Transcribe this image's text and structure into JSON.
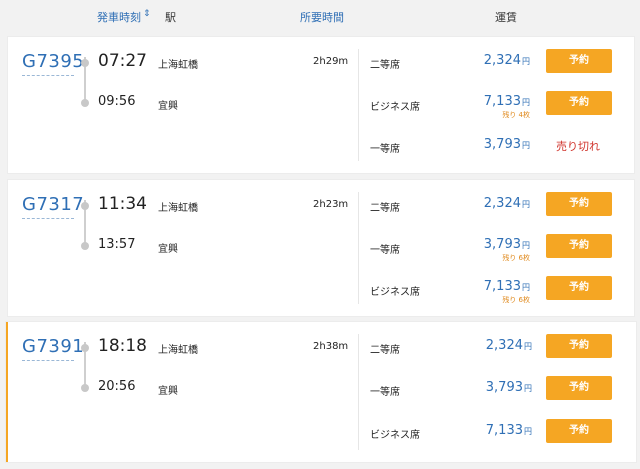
{
  "header": {
    "departure_label": "発車時刻",
    "sort_icon": "⇕",
    "station_label": "駅",
    "duration_label": "所要時間",
    "fare_label": "運賃"
  },
  "trains": [
    {
      "number": "G7395",
      "dep_time": "07:27",
      "arr_time": "09:56",
      "dep_station": "上海虹橋",
      "arr_station": "宜興",
      "duration": "2h29m",
      "fares": [
        {
          "class": "二等席",
          "price": "2,324",
          "yen": "円",
          "remaining": "",
          "action": "予約"
        },
        {
          "class": "ビジネス席",
          "price": "7,133",
          "yen": "円",
          "remaining": "残り 4枚",
          "action": "予約"
        },
        {
          "class": "一等席",
          "price": "3,793",
          "yen": "円",
          "remaining": "",
          "action": "売り切れ"
        }
      ]
    },
    {
      "number": "G7317",
      "dep_time": "11:34",
      "arr_time": "13:57",
      "dep_station": "上海虹橋",
      "arr_station": "宜興",
      "duration": "2h23m",
      "fares": [
        {
          "class": "二等席",
          "price": "2,324",
          "yen": "円",
          "remaining": "",
          "action": "予約"
        },
        {
          "class": "一等席",
          "price": "3,793",
          "yen": "円",
          "remaining": "残り 6枚",
          "action": "予約"
        },
        {
          "class": "ビジネス席",
          "price": "7,133",
          "yen": "円",
          "remaining": "残り 6枚",
          "action": "予約"
        }
      ]
    },
    {
      "number": "G7391",
      "dep_time": "18:18",
      "arr_time": "20:56",
      "dep_station": "上海虹橋",
      "arr_station": "宜興",
      "duration": "2h38m",
      "fares": [
        {
          "class": "二等席",
          "price": "2,324",
          "yen": "円",
          "remaining": "",
          "action": "予約"
        },
        {
          "class": "一等席",
          "price": "3,793",
          "yen": "円",
          "remaining": "",
          "action": "予約"
        },
        {
          "class": "ビジネス席",
          "price": "7,133",
          "yen": "円",
          "remaining": "",
          "action": "予約"
        }
      ]
    }
  ],
  "colors": {
    "accent": "#f5a623",
    "link": "#2f6fb5",
    "soldout": "#d0342c",
    "remaining": "#e08a1e"
  }
}
